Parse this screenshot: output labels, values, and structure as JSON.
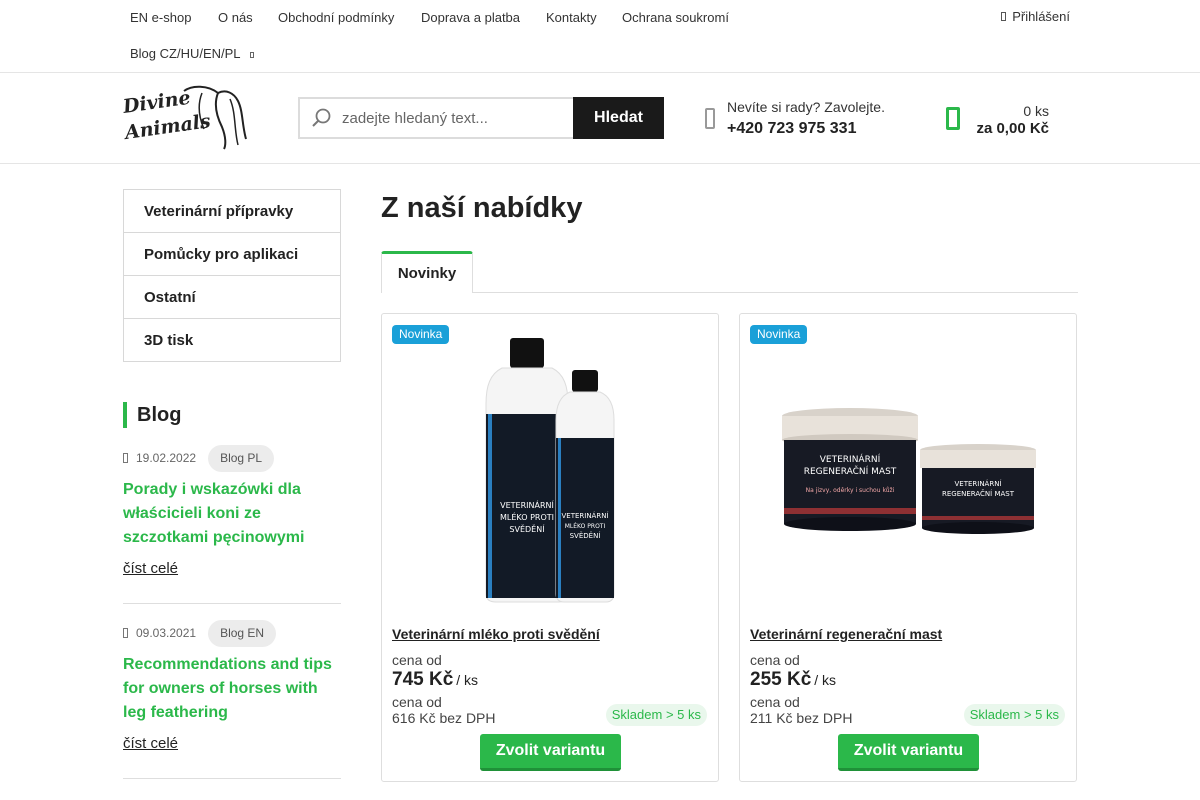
{
  "topnav": {
    "links": [
      "EN e-shop",
      "O nás",
      "Obchodní podmínky",
      "Doprava a platba",
      "Kontakty",
      "Ochrana soukromí"
    ],
    "blog_link": "Blog CZ/HU/EN/PL",
    "login": "Přihlášení"
  },
  "header": {
    "logo_text": "Divine Animals",
    "search_placeholder": "zadejte hledaný text...",
    "search_button": "Hledat",
    "help_text": "Nevíte si rady? Zavolejte.",
    "phone": "+420 723 975 331",
    "cart_qty": "0 ks",
    "cart_total": "za 0,00 Kč",
    "accent": "#2bb84a"
  },
  "sidebar": {
    "categories": [
      "Veterinární přípravky",
      "Pomůcky pro aplikaci",
      "Ostatní",
      "3D tisk"
    ],
    "blog_title": "Blog",
    "posts": [
      {
        "date": "19.02.2022",
        "tag": "Blog PL",
        "title": "Porady i wskazówki dla właścicieli koni ze szczotkami pęcinowymi",
        "more": "číst celé"
      },
      {
        "date": "09.03.2021",
        "tag": "Blog EN",
        "title": "Recommendations and tips for owners of horses with leg feathering",
        "more": "číst celé"
      }
    ]
  },
  "main": {
    "title": "Z naší nabídky",
    "tab": "Novinky",
    "products": [
      {
        "badge": "Novinka",
        "name": "Veterinární mléko proti svědění",
        "price_label": "cena od",
        "price": "745 Kč",
        "unit": "/ ks",
        "net_label": "cena od",
        "net_price": "616 Kč bez DPH",
        "stock": "Skladem > 5 ks",
        "button": "Zvolit variantu",
        "label_line1": "VETERINÁRNÍ",
        "label_line2": "MLÉKO PROTI",
        "label_line3": "SVĚDĚNÍ"
      },
      {
        "badge": "Novinka",
        "name": "Veterinární regenerační mast",
        "price_label": "cena od",
        "price": "255 Kč",
        "unit": "/ ks",
        "net_label": "cena od",
        "net_price": "211 Kč bez DPH",
        "stock": "Skladem > 5 ks",
        "button": "Zvolit variantu",
        "label_line1": "VETERINÁRNÍ",
        "label_line2": "REGENERAČNÍ MAST",
        "label_line3": "Na jizvy, oděrky i suchou kůži"
      }
    ]
  }
}
